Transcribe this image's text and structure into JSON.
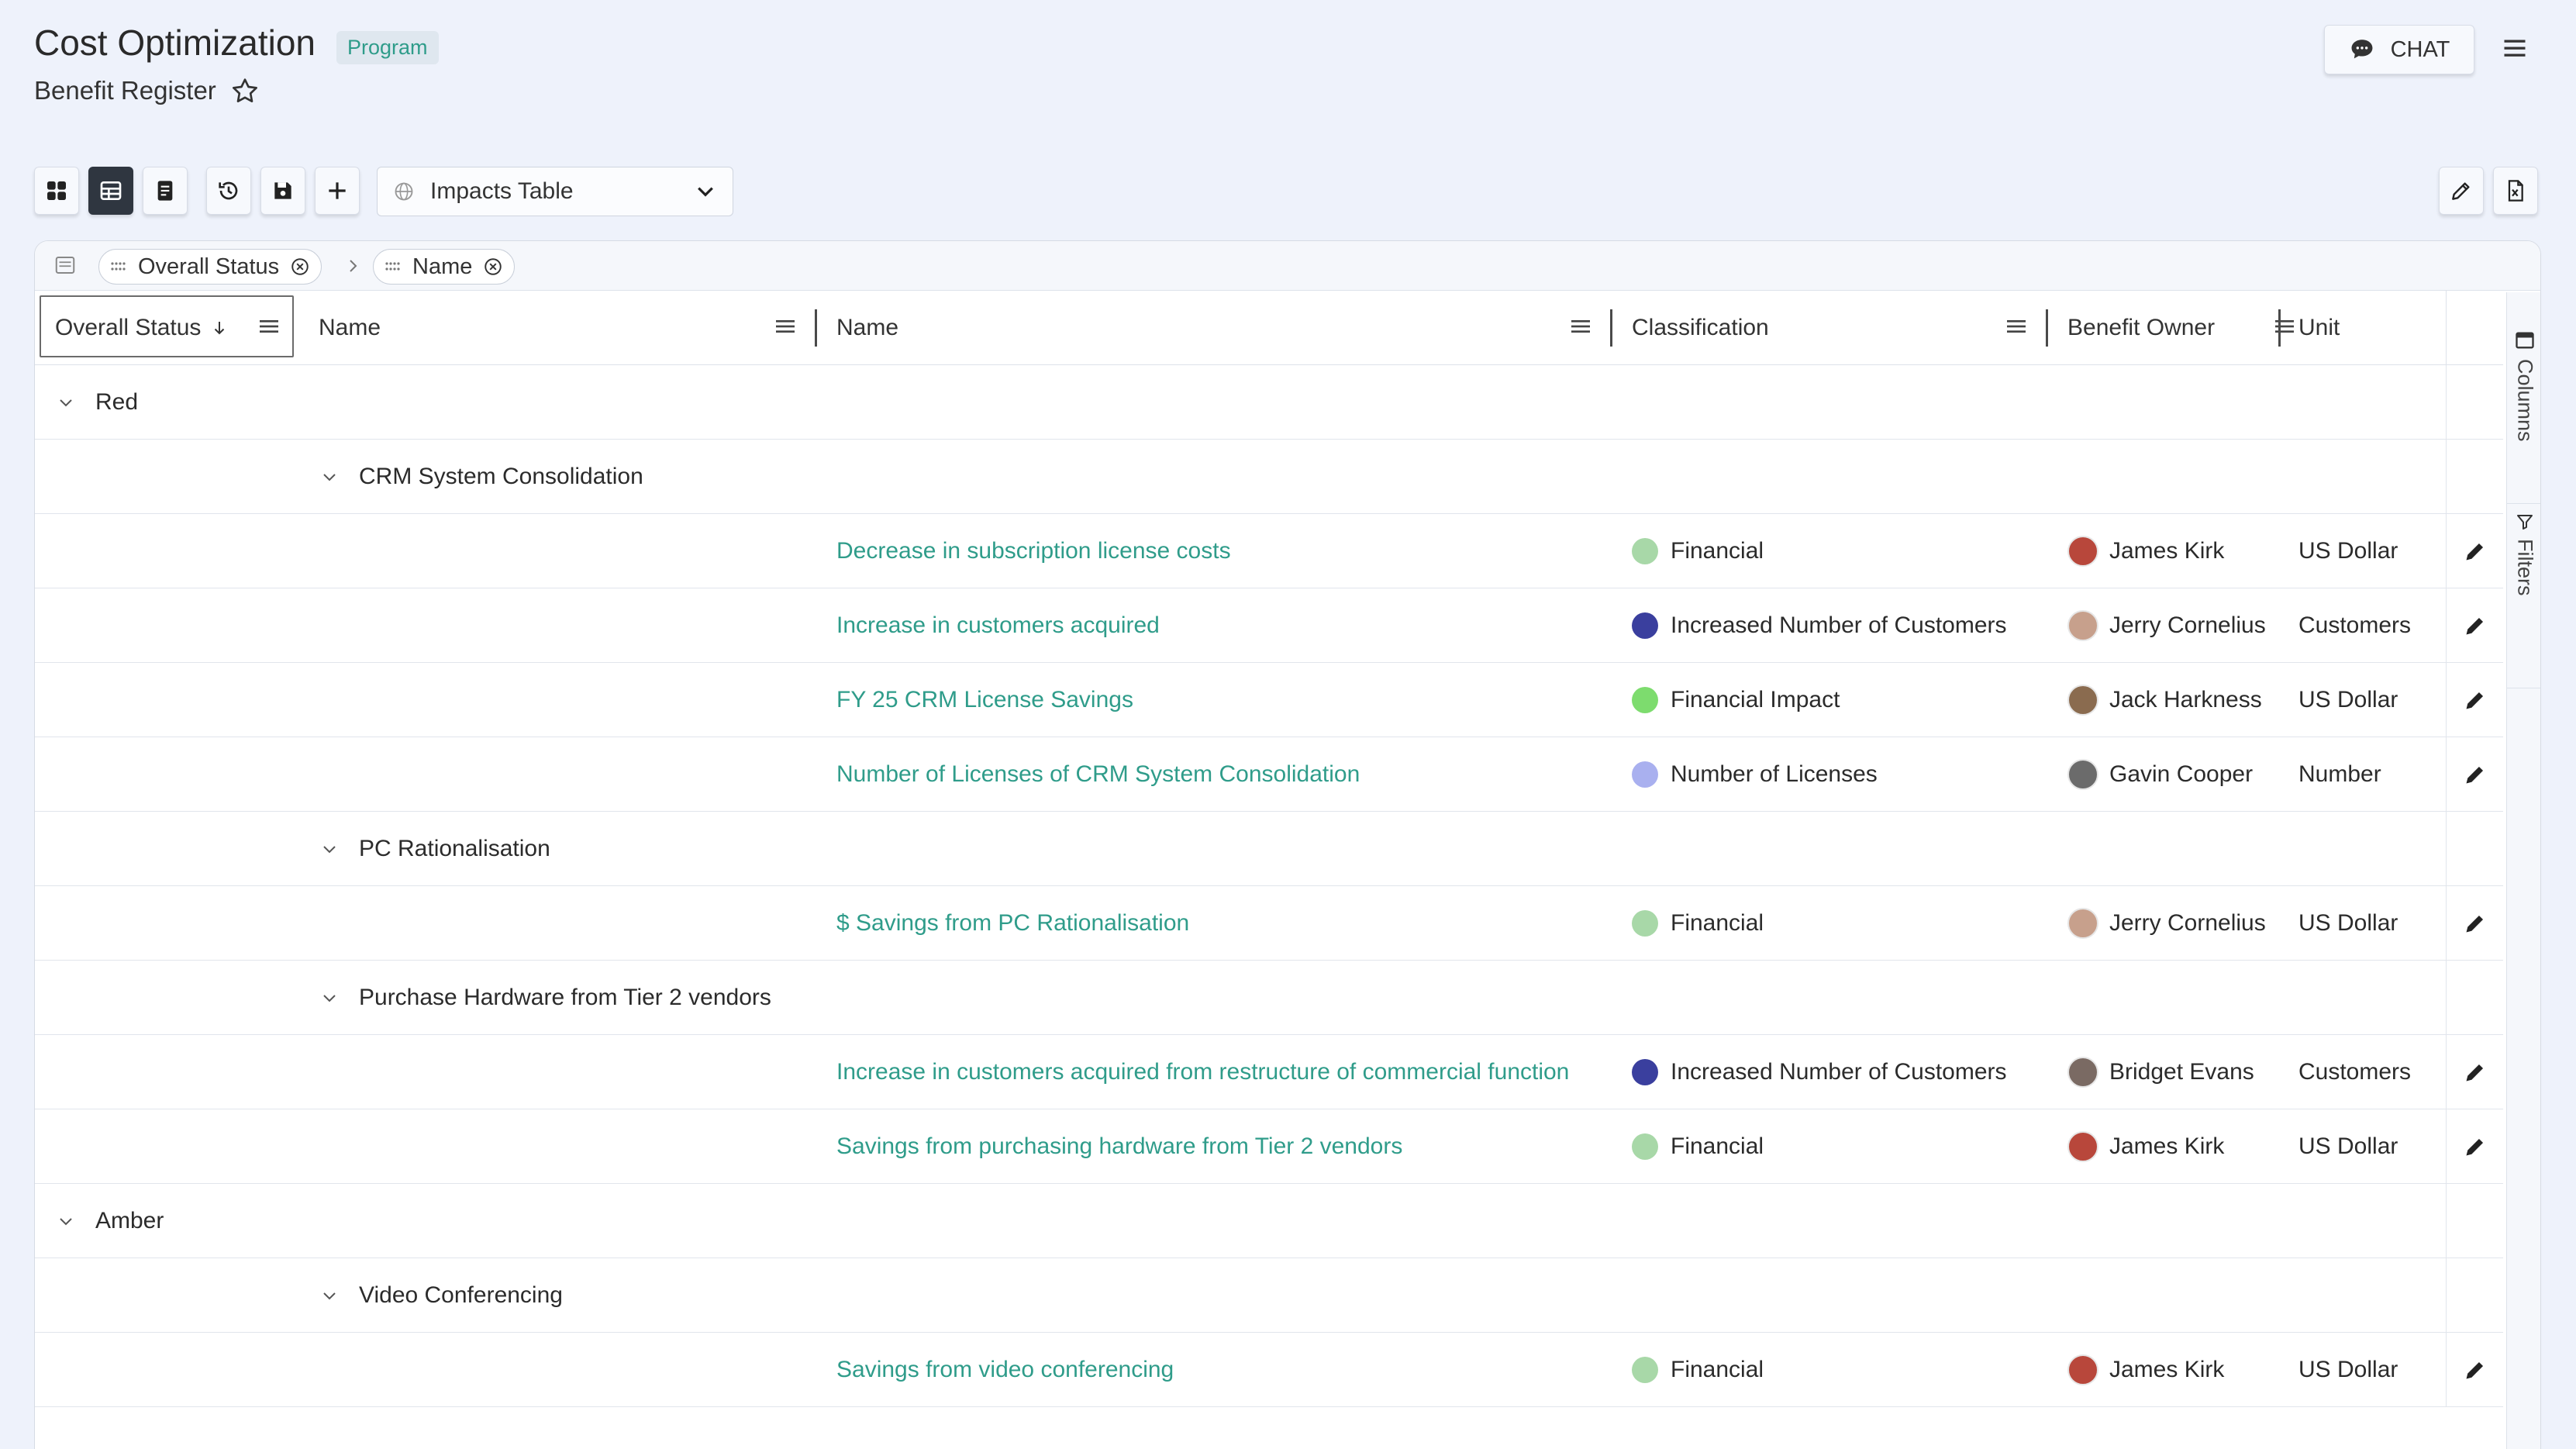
{
  "header": {
    "title": "Cost Optimization",
    "badge": "Program",
    "subtitle": "Benefit Register",
    "chat_label": "CHAT"
  },
  "toolbar": {
    "view_select": "Impacts Table",
    "buttons": [
      "grid-view-icon",
      "table-view-icon",
      "report-icon",
      "history-icon",
      "save-icon",
      "add-icon"
    ],
    "right_buttons": [
      "edit-icon",
      "excel-export-icon"
    ]
  },
  "grouping": {
    "chips": [
      "Overall Status",
      "Name"
    ]
  },
  "columns": {
    "overall_status": "Overall Status",
    "group_name": "Name",
    "name": "Name",
    "classification": "Classification",
    "benefit_owner": "Benefit Owner",
    "unit": "Unit"
  },
  "side_rail": {
    "columns": "Columns",
    "filters": "Filters"
  },
  "rows": [
    {
      "type": "status",
      "label": "Red"
    },
    {
      "type": "group",
      "label": "CRM System Consolidation"
    },
    {
      "type": "item",
      "name": "Decrease in subscription license costs",
      "classification": "Financial",
      "dot": "#a8d8a8",
      "owner": "James Kirk",
      "avatar": "#b8473b",
      "unit": "US Dollar"
    },
    {
      "type": "item",
      "name": "Increase in customers acquired",
      "classification": "Increased Number of Customers",
      "dot": "#3a3f9e",
      "owner": "Jerry Cornelius",
      "avatar": "#c7a08c",
      "unit": "Customers"
    },
    {
      "type": "item",
      "name": "FY 25 CRM License Savings",
      "classification": "Financial Impact",
      "dot": "#7ddc6e",
      "owner": "Jack Harkness",
      "avatar": "#8a6b4f",
      "unit": "US Dollar"
    },
    {
      "type": "item",
      "name": "Number of Licenses of CRM System Consolidation",
      "classification": "Number of Licenses",
      "dot": "#a9b0ef",
      "owner": "Gavin Cooper",
      "avatar": "#6b6b6b",
      "unit": "Number"
    },
    {
      "type": "group",
      "label": "PC Rationalisation"
    },
    {
      "type": "item",
      "name": "$ Savings from PC Rationalisation",
      "classification": "Financial",
      "dot": "#a8d8a8",
      "owner": "Jerry Cornelius",
      "avatar": "#c7a08c",
      "unit": "US Dollar"
    },
    {
      "type": "group",
      "label": "Purchase Hardware from Tier 2 vendors"
    },
    {
      "type": "item",
      "name": "Increase in customers acquired from restructure of commercial function",
      "classification": "Increased Number of Customers",
      "dot": "#3a3f9e",
      "owner": "Bridget Evans",
      "avatar": "#7a6a63",
      "unit": "Customers"
    },
    {
      "type": "item",
      "name": "Savings from purchasing hardware from Tier 2 vendors",
      "classification": "Financial",
      "dot": "#a8d8a8",
      "owner": "James Kirk",
      "avatar": "#b8473b",
      "unit": "US Dollar"
    },
    {
      "type": "status",
      "label": "Amber"
    },
    {
      "type": "group",
      "label": "Video Conferencing"
    },
    {
      "type": "item",
      "name": "Savings from video conferencing",
      "classification": "Financial",
      "dot": "#a8d8a8",
      "owner": "James Kirk",
      "avatar": "#b8473b",
      "unit": "US Dollar"
    }
  ]
}
